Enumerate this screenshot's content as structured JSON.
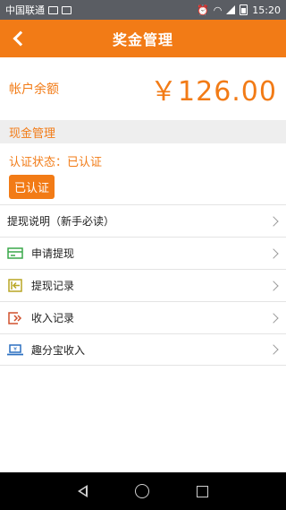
{
  "status_bar": {
    "carrier": "中国联通",
    "time": "15:20",
    "icons": [
      "image-icon",
      "sd-card-icon",
      "alarm-icon",
      "wifi-icon",
      "signal-icon",
      "battery-icon"
    ]
  },
  "app_bar": {
    "title": "奖金管理",
    "back_icon": "back-arrow-icon"
  },
  "balance": {
    "label": "帐户余额",
    "value": "￥126.00"
  },
  "section": {
    "title": "现金管理"
  },
  "certification": {
    "status_text": "认证状态：已认证",
    "button_label": "已认证"
  },
  "menu": {
    "items": [
      {
        "label": "提现说明（新手必读）",
        "icon": ""
      },
      {
        "label": "申请提现",
        "icon": "card-icon",
        "color": "#3aa84a"
      },
      {
        "label": "提现记录",
        "icon": "record-icon",
        "color": "#b9a624"
      },
      {
        "label": "收入记录",
        "icon": "income-icon",
        "color": "#d0502d"
      },
      {
        "label": "趣分宝收入",
        "icon": "laptop-icon",
        "color": "#2a6fc0"
      }
    ]
  },
  "colors": {
    "accent": "#f27b16",
    "status_bar": "#5a5d63",
    "nav_bar": "#000000",
    "section_bg": "#eeeeee"
  }
}
